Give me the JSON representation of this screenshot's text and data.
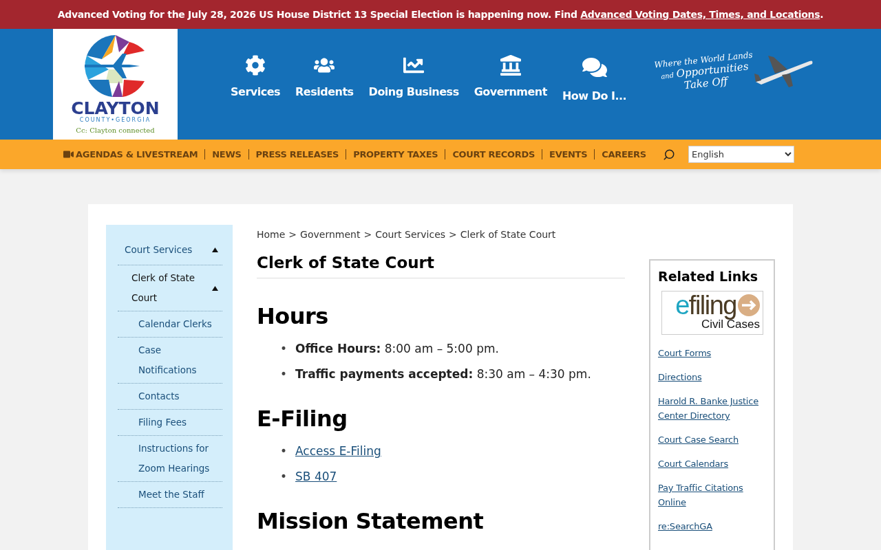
{
  "alert_banner": {
    "text": "Advanced Voting for the July 28, 2026 US House District 13 Special Election is happening now. Find ",
    "link": "Advanced Voting Dates, Times, and Locations",
    "suffix": "."
  },
  "logo": {
    "name": "CLAYTON",
    "region": "COUNTY•GEORGIA",
    "tagline": "Cc: Clayton connected"
  },
  "main_nav": [
    {
      "label": "Services",
      "kind": "services"
    },
    {
      "label": "Residents",
      "kind": "residents"
    },
    {
      "label": "Doing Business",
      "kind": "business"
    },
    {
      "label": "Government",
      "kind": "government"
    },
    {
      "label": "How Do I...",
      "kind": "help"
    }
  ],
  "slogan": {
    "line_1": "Where the World Lands",
    "small": "and",
    "line_2": "Opportunities",
    "line_3": "Take Off"
  },
  "utility_nav": [
    {
      "label": "AGENDAS & LIVESTREAM",
      "kind": "video"
    },
    {
      "label": "NEWS",
      "kind": "plain"
    },
    {
      "label": "PRESS RELEASES",
      "kind": "plain"
    },
    {
      "label": "PROPERTY TAXES",
      "kind": "plain"
    },
    {
      "label": "COURT RECORDS",
      "kind": "plain"
    },
    {
      "label": "EVENTS",
      "kind": "plain"
    },
    {
      "label": "CAREERS",
      "kind": "plain"
    }
  ],
  "language_select": {
    "value": "English"
  },
  "sidebar": {
    "items": [
      {
        "label": "Court Services",
        "selected": false,
        "expanded": true,
        "children": [
          {
            "label": "Clerk of State Court",
            "selected": true,
            "expanded": true,
            "children": [
              {
                "label": "Calendar Clerks",
                "selected": false
              },
              {
                "label": "Case Notifications",
                "selected": false
              },
              {
                "label": "Contacts",
                "selected": false
              },
              {
                "label": "Filing Fees",
                "selected": false
              },
              {
                "label": "Instructions for Zoom Hearings",
                "selected": false
              },
              {
                "label": "Meet the Staff",
                "selected": false
              }
            ]
          }
        ]
      }
    ]
  },
  "breadcrumb": [
    {
      "label": "Home"
    },
    {
      "separator": ">",
      "label": "Government"
    },
    {
      "separator": ">",
      "label": "Court Services"
    },
    {
      "separator": ">",
      "label": "Clerk of State Court"
    }
  ],
  "page_title": "Clerk of State Court",
  "sections": [
    {
      "heading": "Hours",
      "items": [
        {
          "kind": "text",
          "bullet": "•",
          "text": "**Office Hours:** 8:00 am – 5:00 pm."
        },
        {
          "kind": "text",
          "bullet": "•",
          "text": "**Traffic payments accepted:** 8:30 am – 4:30 pm."
        }
      ]
    },
    {
      "heading": "E-Filing",
      "items": [
        {
          "kind": "link",
          "bullet": "•",
          "text": "Access E-Filing"
        },
        {
          "kind": "link",
          "bullet": "•",
          "text": "SB 407"
        }
      ]
    },
    {
      "heading": "Mission Statement"
    }
  ],
  "related_links": {
    "title": "Related Links",
    "banner": {
      "word": "efiling",
      "caption": "Civil Cases"
    },
    "links": [
      "Court Forms",
      "Directions",
      "Harold R. Banke Justice Center Directory",
      "Court Case Search",
      "Court Calendars",
      "Pay Traffic Citations Online",
      "re:SearchGA"
    ]
  }
}
